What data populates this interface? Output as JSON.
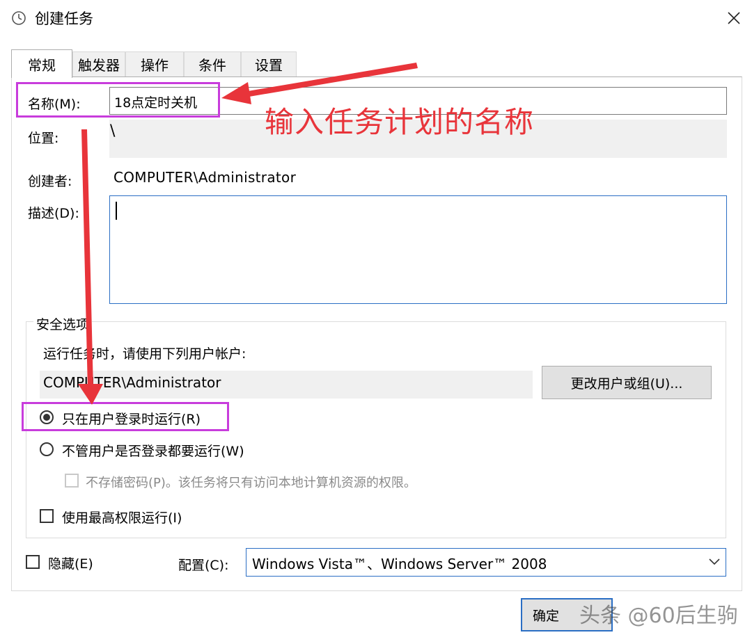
{
  "window": {
    "title": "创建任务",
    "close_glyph": "✕"
  },
  "tabs": [
    {
      "label": "常规",
      "active": true
    },
    {
      "label": "触发器"
    },
    {
      "label": "操作"
    },
    {
      "label": "条件"
    },
    {
      "label": "设置"
    }
  ],
  "general": {
    "name_label": "名称(M):",
    "name_value": "18点定时关机",
    "location_label": "位置:",
    "location_value": "\\",
    "author_label": "创建者:",
    "author_value": "COMPUTER\\Administrator",
    "description_label": "描述(D):",
    "description_value": ""
  },
  "security": {
    "legend": "安全选项",
    "run_as_prompt": "运行任务时，请使用下列用户帐户:",
    "account_value": "COMPUTER\\Administrator",
    "change_user_button": "更改用户或组(U)...",
    "radio_logged_on": "只在用户登录时运行(R)",
    "radio_whether_logged": "不管用户是否登录都要运行(W)",
    "selected_radio": "logged_on",
    "no_store_password": "不存储密码(P)。该任务将只有访问本地计算机资源的权限。",
    "highest_privileges": "使用最高权限运行(I)"
  },
  "bottom": {
    "hidden_label": "隐藏(E)",
    "config_label": "配置(C):",
    "config_value": "Windows Vista™、Windows Server™ 2008",
    "ok_button": "确定"
  },
  "annotation": {
    "text": "输入任务计划的名称",
    "color": "#e8343a",
    "highlight_color": "#c83cdc"
  },
  "watermark": "头条 @60后生驹"
}
